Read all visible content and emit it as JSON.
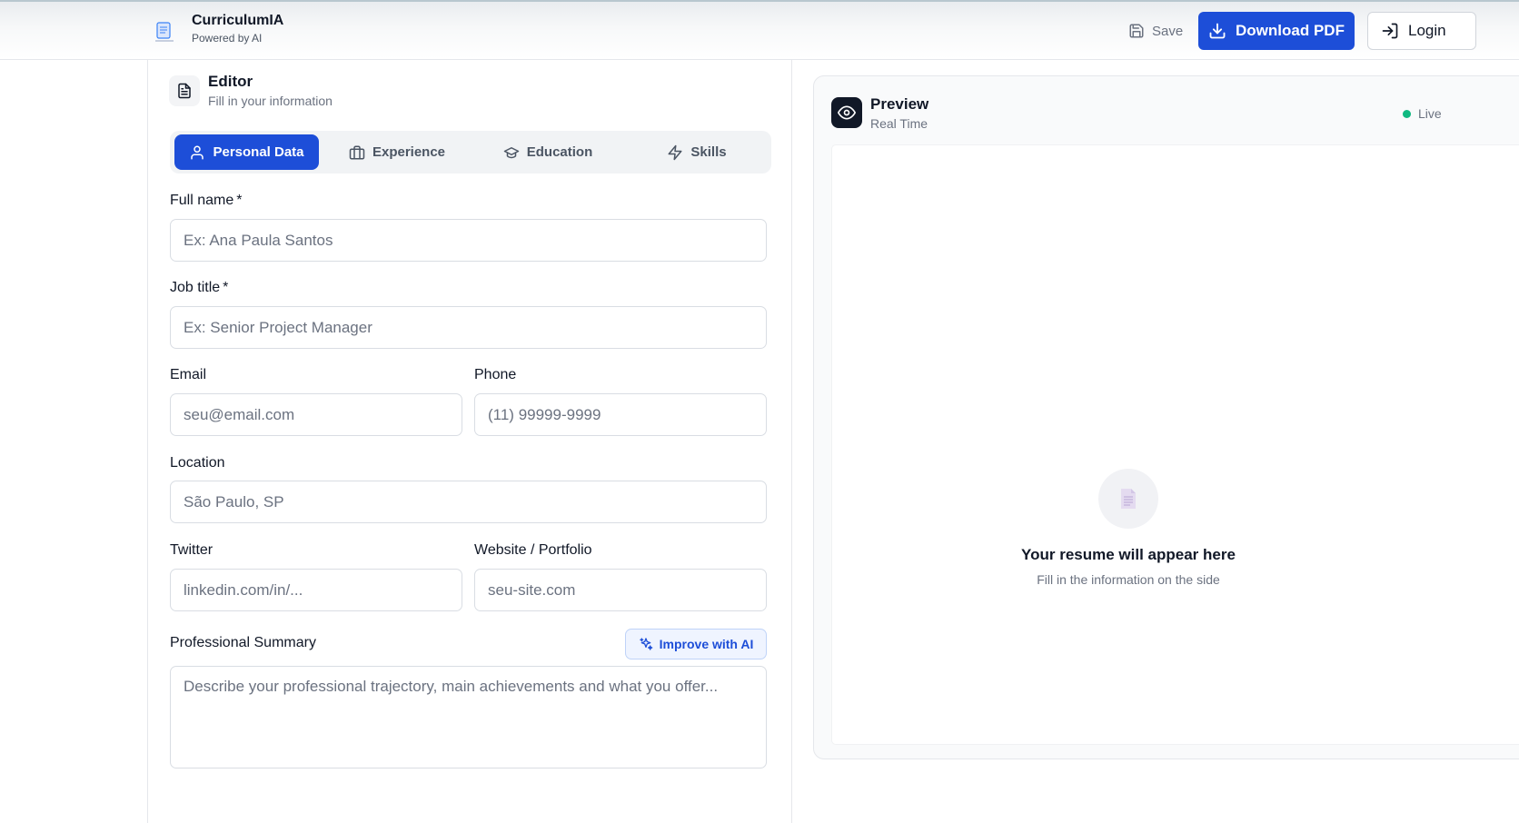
{
  "header": {
    "brand_title": "CurriculumIA",
    "brand_subtitle": "Powered by AI",
    "save_label": "Save",
    "download_label": "Download PDF",
    "login_label": "Login"
  },
  "editor": {
    "title": "Editor",
    "subtitle": "Fill in your information",
    "tabs": [
      {
        "label": "Personal Data",
        "icon": "user-icon",
        "active": true
      },
      {
        "label": "Experience",
        "icon": "briefcase-icon",
        "active": false
      },
      {
        "label": "Education",
        "icon": "graduation-cap-icon",
        "active": false
      },
      {
        "label": "Skills",
        "icon": "lightning-icon",
        "active": false
      }
    ],
    "fields": {
      "full_name": {
        "label": "Full name",
        "required_mark": "*",
        "placeholder": "Ex: Ana Paula Santos",
        "value": ""
      },
      "job_title": {
        "label": "Job title",
        "required_mark": "*",
        "placeholder": "Ex: Senior Project Manager",
        "value": ""
      },
      "email": {
        "label": "Email",
        "placeholder": "seu@email.com",
        "value": ""
      },
      "phone": {
        "label": "Phone",
        "placeholder": "(11) 99999-9999",
        "value": ""
      },
      "location": {
        "label": "Location",
        "placeholder": "São Paulo, SP",
        "value": ""
      },
      "twitter": {
        "label": "Twitter",
        "placeholder": "linkedin.com/in/...",
        "value": ""
      },
      "website": {
        "label": "Website / Portfolio",
        "placeholder": "seu-site.com",
        "value": ""
      },
      "summary": {
        "label": "Professional Summary",
        "placeholder": "Describe your professional trajectory, main achievements and what you offer...",
        "value": ""
      }
    },
    "improve_ai_label": "Improve with AI"
  },
  "preview": {
    "title": "Preview",
    "subtitle": "Real Time",
    "status_label": "Live",
    "empty_title": "Your resume will appear here",
    "empty_subtitle": "Fill in the information on the side"
  },
  "colors": {
    "accent": "#1d4ed8",
    "live_dot": "#10b981"
  }
}
